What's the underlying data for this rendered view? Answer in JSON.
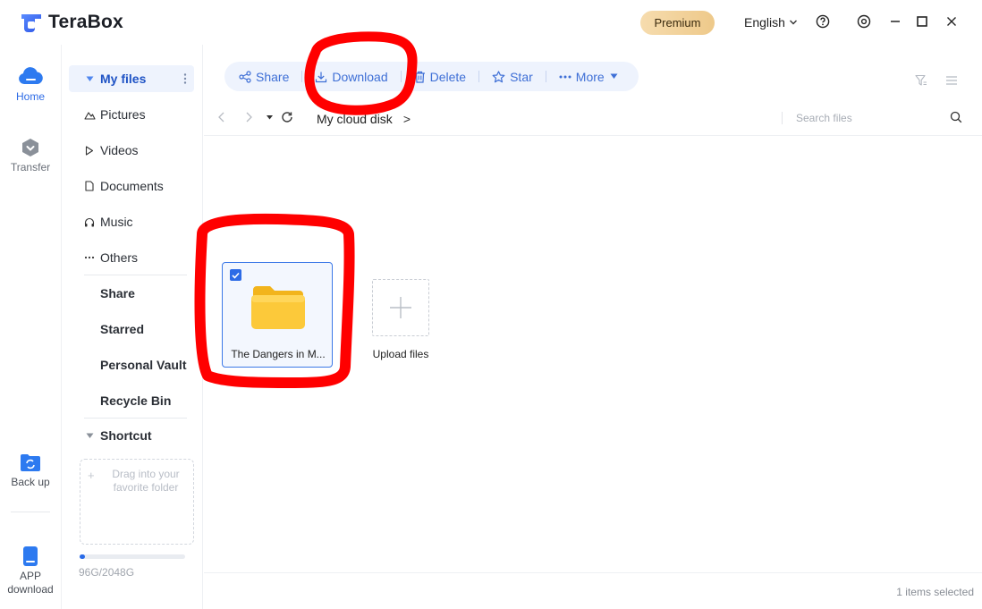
{
  "app": {
    "name": "TeraBox"
  },
  "titlebar": {
    "premium_label": "Premium",
    "language": "English",
    "help_icon": "help-circle-icon",
    "settings_icon": "settings-icon",
    "minimize_icon": "minimize-icon",
    "maximize_icon": "maximize-icon",
    "close_icon": "close-icon"
  },
  "rail": {
    "items": [
      {
        "label": "Home",
        "icon": "cloud-icon",
        "active": true
      },
      {
        "label": "Transfer",
        "icon": "transfer-icon"
      },
      {
        "label": "Back up",
        "icon": "backup-icon"
      },
      {
        "label": "APP download",
        "line1": "APP",
        "line2": "download",
        "icon": "phone-icon"
      }
    ]
  },
  "sidebar": {
    "root_label": "My files",
    "categories": [
      {
        "label": "Pictures",
        "icon": "pictures-icon"
      },
      {
        "label": "Videos",
        "icon": "play-icon"
      },
      {
        "label": "Documents",
        "icon": "document-icon"
      },
      {
        "label": "Music",
        "icon": "headphones-icon"
      },
      {
        "label": "Others",
        "icon": "ellipsis-icon"
      }
    ],
    "sections": [
      "Share",
      "Starred",
      "Personal Vault",
      "Recycle Bin"
    ],
    "shortcut_label": "Shortcut",
    "dropzone_text": "Drag into your favorite folder",
    "quota_text": "96G/2048G",
    "quota_fraction": 0.047
  },
  "toolbar": {
    "share": "Share",
    "download": "Download",
    "delete": "Delete",
    "star": "Star",
    "more": "More"
  },
  "pathbar": {
    "breadcrumb": "My cloud disk",
    "breadcrumb_sep": ">",
    "search_placeholder": "Search files"
  },
  "files": [
    {
      "name": "The Dangers in M...",
      "type": "folder",
      "selected": true
    }
  ],
  "upload_label": "Upload files",
  "status": {
    "selected_text": "1 items selected"
  },
  "colors": {
    "accent": "#2d6be6",
    "annotation": "#ff0000",
    "premium": "#f2d29c"
  }
}
